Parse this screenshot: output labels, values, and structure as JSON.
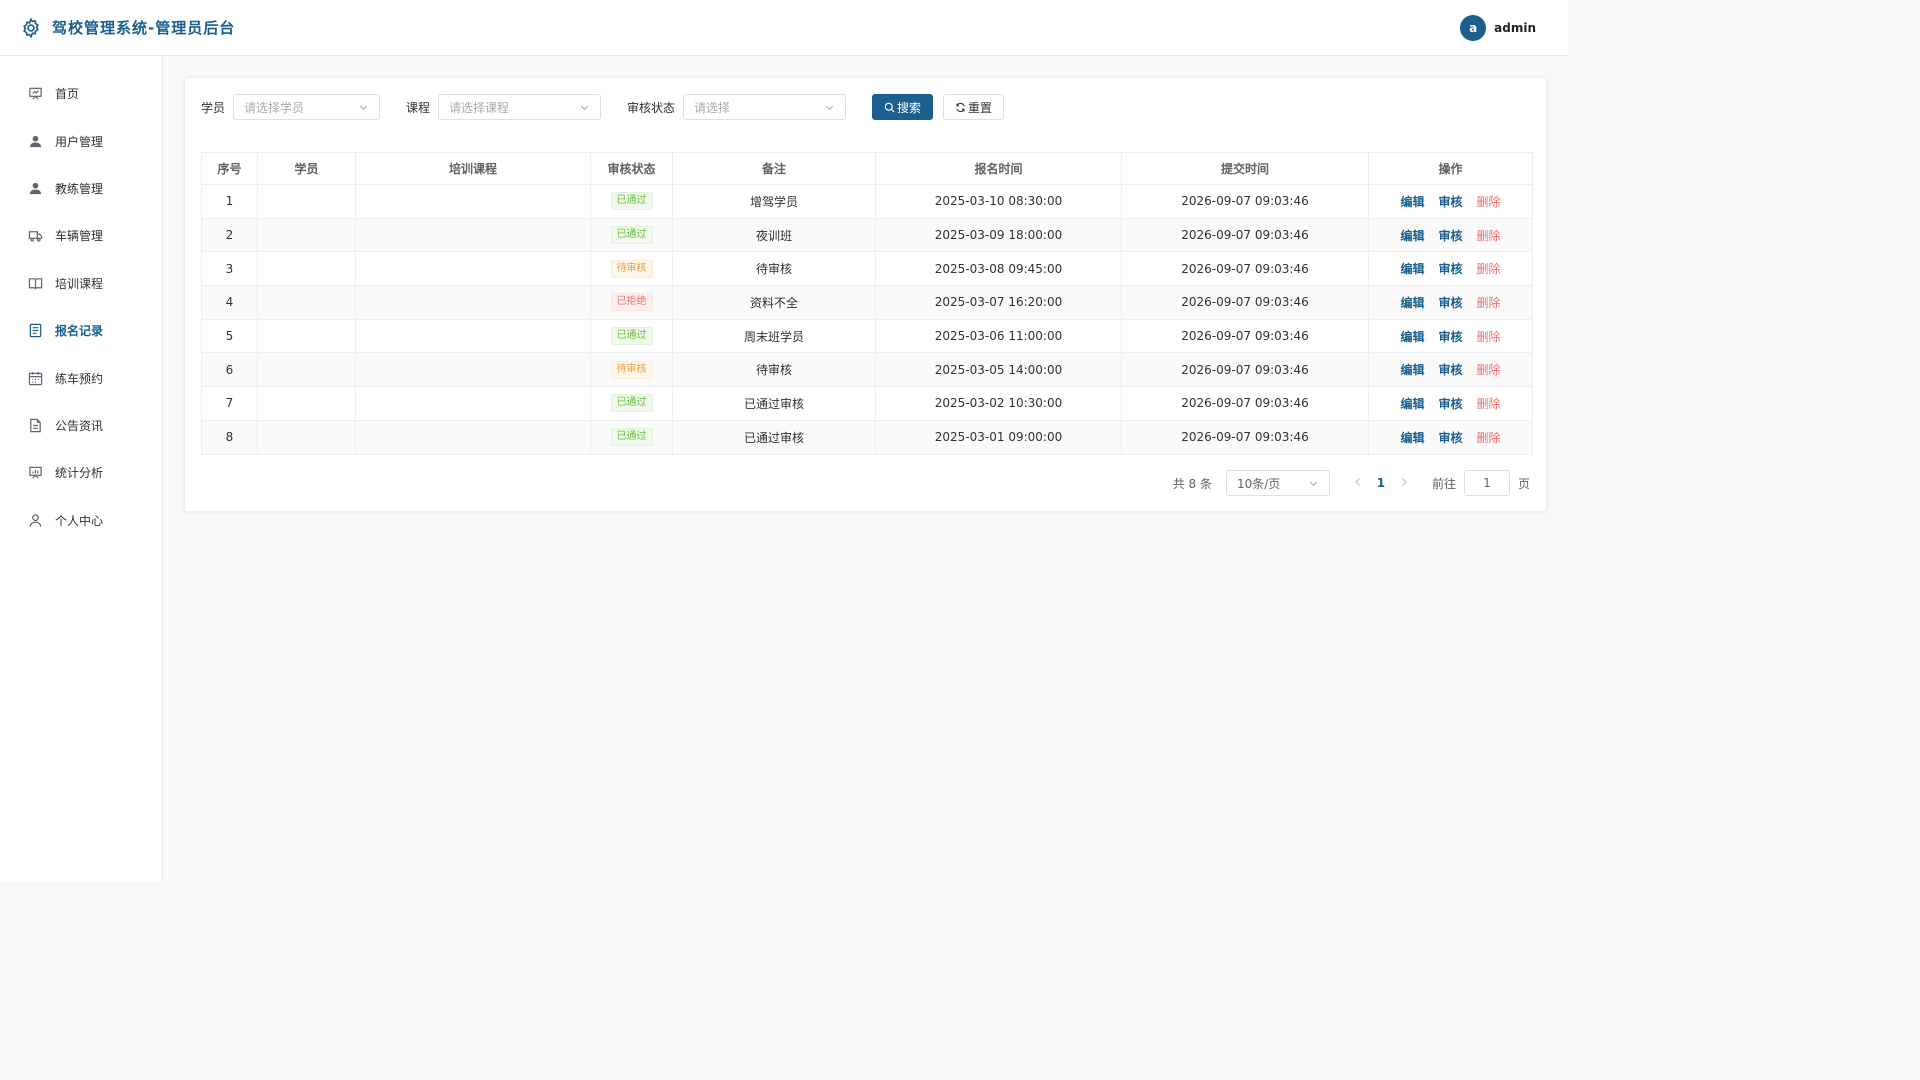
{
  "header": {
    "title": "驾校管理系统-管理员后台",
    "avatar_letter": "a",
    "username": "admin"
  },
  "sidebar": {
    "items": [
      {
        "label": "首页",
        "icon": "dashboard-icon"
      },
      {
        "label": "用户管理",
        "icon": "user-icon"
      },
      {
        "label": "教练管理",
        "icon": "coach-icon"
      },
      {
        "label": "车辆管理",
        "icon": "truck-icon"
      },
      {
        "label": "培训课程",
        "icon": "book-icon"
      },
      {
        "label": "报名记录",
        "icon": "document-icon",
        "active": true
      },
      {
        "label": "练车预约",
        "icon": "calendar-icon"
      },
      {
        "label": "公告资讯",
        "icon": "notice-icon"
      },
      {
        "label": "统计分析",
        "icon": "chart-icon"
      },
      {
        "label": "个人中心",
        "icon": "profile-icon"
      }
    ]
  },
  "filters": {
    "student_label": "学员",
    "student_placeholder": "请选择学员",
    "course_label": "课程",
    "course_placeholder": "请选择课程",
    "status_label": "审核状态",
    "status_placeholder": "请选择",
    "search_label": "搜索",
    "reset_label": "重置"
  },
  "table": {
    "headers": [
      "序号",
      "学员",
      "培训课程",
      "审核状态",
      "备注",
      "报名时间",
      "提交时间",
      "操作"
    ],
    "actions": {
      "edit": "编辑",
      "audit": "审核",
      "delete": "删除"
    },
    "rows": [
      {
        "no": "1",
        "student": "",
        "course": "",
        "status": "已通过",
        "status_type": "pass",
        "remark": "增驾学员",
        "signup_time": "2025-03-10 08:30:00",
        "submit_time": "2026-09-07 09:03:46"
      },
      {
        "no": "2",
        "student": "",
        "course": "",
        "status": "已通过",
        "status_type": "pass",
        "remark": "夜训班",
        "signup_time": "2025-03-09 18:00:00",
        "submit_time": "2026-09-07 09:03:46"
      },
      {
        "no": "3",
        "student": "",
        "course": "",
        "status": "待审核",
        "status_type": "pending",
        "remark": "待审核",
        "signup_time": "2025-03-08 09:45:00",
        "submit_time": "2026-09-07 09:03:46"
      },
      {
        "no": "4",
        "student": "",
        "course": "",
        "status": "已拒绝",
        "status_type": "reject",
        "remark": "资料不全",
        "signup_time": "2025-03-07 16:20:00",
        "submit_time": "2026-09-07 09:03:46"
      },
      {
        "no": "5",
        "student": "",
        "course": "",
        "status": "已通过",
        "status_type": "pass",
        "remark": "周末班学员",
        "signup_time": "2025-03-06 11:00:00",
        "submit_time": "2026-09-07 09:03:46"
      },
      {
        "no": "6",
        "student": "",
        "course": "",
        "status": "待审核",
        "status_type": "pending",
        "remark": "待审核",
        "signup_time": "2025-03-05 14:00:00",
        "submit_time": "2026-09-07 09:03:46"
      },
      {
        "no": "7",
        "student": "",
        "course": "",
        "status": "已通过",
        "status_type": "pass",
        "remark": "已通过审核",
        "signup_time": "2025-03-02 10:30:00",
        "submit_time": "2026-09-07 09:03:46"
      },
      {
        "no": "8",
        "student": "",
        "course": "",
        "status": "已通过",
        "status_type": "pass",
        "remark": "已通过审核",
        "signup_time": "2025-03-01 09:00:00",
        "submit_time": "2026-09-07 09:03:46"
      }
    ]
  },
  "pagination": {
    "total_text": "共 8 条",
    "page_size": "10条/页",
    "current_page": "1",
    "goto_label": "前往",
    "goto_value": "1",
    "page_suffix": "页"
  },
  "colors": {
    "accent": "#1a5f8e",
    "pass": "#67c23a",
    "pending": "#e6a23c",
    "reject": "#f56c6c"
  }
}
